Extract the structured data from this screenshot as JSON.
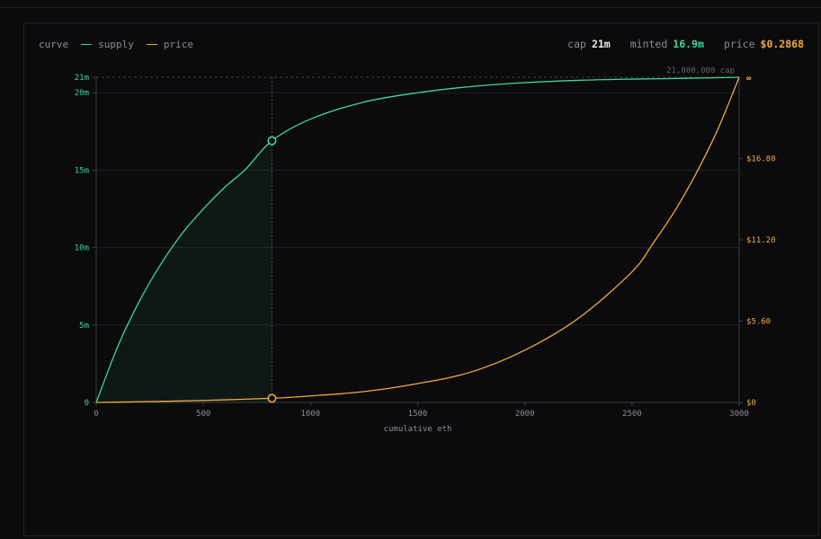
{
  "legend": {
    "label": "curve",
    "items": [
      {
        "name": "supply",
        "color": "#3fd6a0"
      },
      {
        "name": "price",
        "color": "#f0a93e"
      }
    ]
  },
  "stats": {
    "cap_label": "cap",
    "cap_value": "21m",
    "minted_label": "minted",
    "minted_value": "16.9m",
    "price_label": "price",
    "price_value": "$0.2868"
  },
  "colors": {
    "supply": "#3fd6a0",
    "price": "#f0a93e",
    "grid": "#1e2024",
    "axis": "#3a3c41",
    "muted": "#8a8d93"
  },
  "chart_data": {
    "type": "line",
    "xlabel": "cumulative eth",
    "xlim": [
      0,
      3000
    ],
    "x_ticks": [
      0,
      500,
      1000,
      1500,
      2000,
      2500,
      3000
    ],
    "y_left": {
      "lim": [
        0,
        21000000
      ],
      "ticks": [
        0,
        5000000,
        10000000,
        15000000,
        20000000,
        21000000
      ],
      "tick_labels": [
        "0",
        "5m",
        "10m",
        "15m",
        "20m",
        "21m"
      ]
    },
    "y_right": {
      "lim": [
        0,
        22.4
      ],
      "ticks": [
        0,
        5.6,
        11.2,
        16.8
      ],
      "tick_labels": [
        "$0",
        "$5.60",
        "$11.20",
        "$16.80"
      ],
      "top_label": "∞"
    },
    "cap_line": {
      "value": 21000000,
      "label": "21,000,000 cap"
    },
    "marker": {
      "x": 820,
      "supply": 16900000,
      "price": 0.2868
    },
    "series": [
      {
        "name": "supply",
        "axis": "left",
        "x": [
          0,
          100,
          200,
          300,
          400,
          500,
          600,
          700,
          820,
          1000,
          1250,
          1500,
          1750,
          2000,
          2250,
          2500,
          2750,
          3000
        ],
        "values": [
          0,
          3600000,
          6500000,
          8900000,
          10900000,
          12500000,
          13900000,
          15100000,
          16900000,
          18300000,
          19400000,
          20000000,
          20400000,
          20650000,
          20800000,
          20880000,
          20930000,
          21000000
        ]
      },
      {
        "name": "price",
        "axis": "right",
        "x": [
          0,
          250,
          500,
          820,
          1000,
          1250,
          1500,
          1750,
          2000,
          2250,
          2500,
          2600,
          2700,
          2800,
          2900,
          3000
        ],
        "values": [
          0.0,
          0.06,
          0.14,
          0.2868,
          0.45,
          0.75,
          1.3,
          2.1,
          3.6,
          5.8,
          9.0,
          11.0,
          13.2,
          15.8,
          18.8,
          22.4
        ]
      }
    ]
  }
}
